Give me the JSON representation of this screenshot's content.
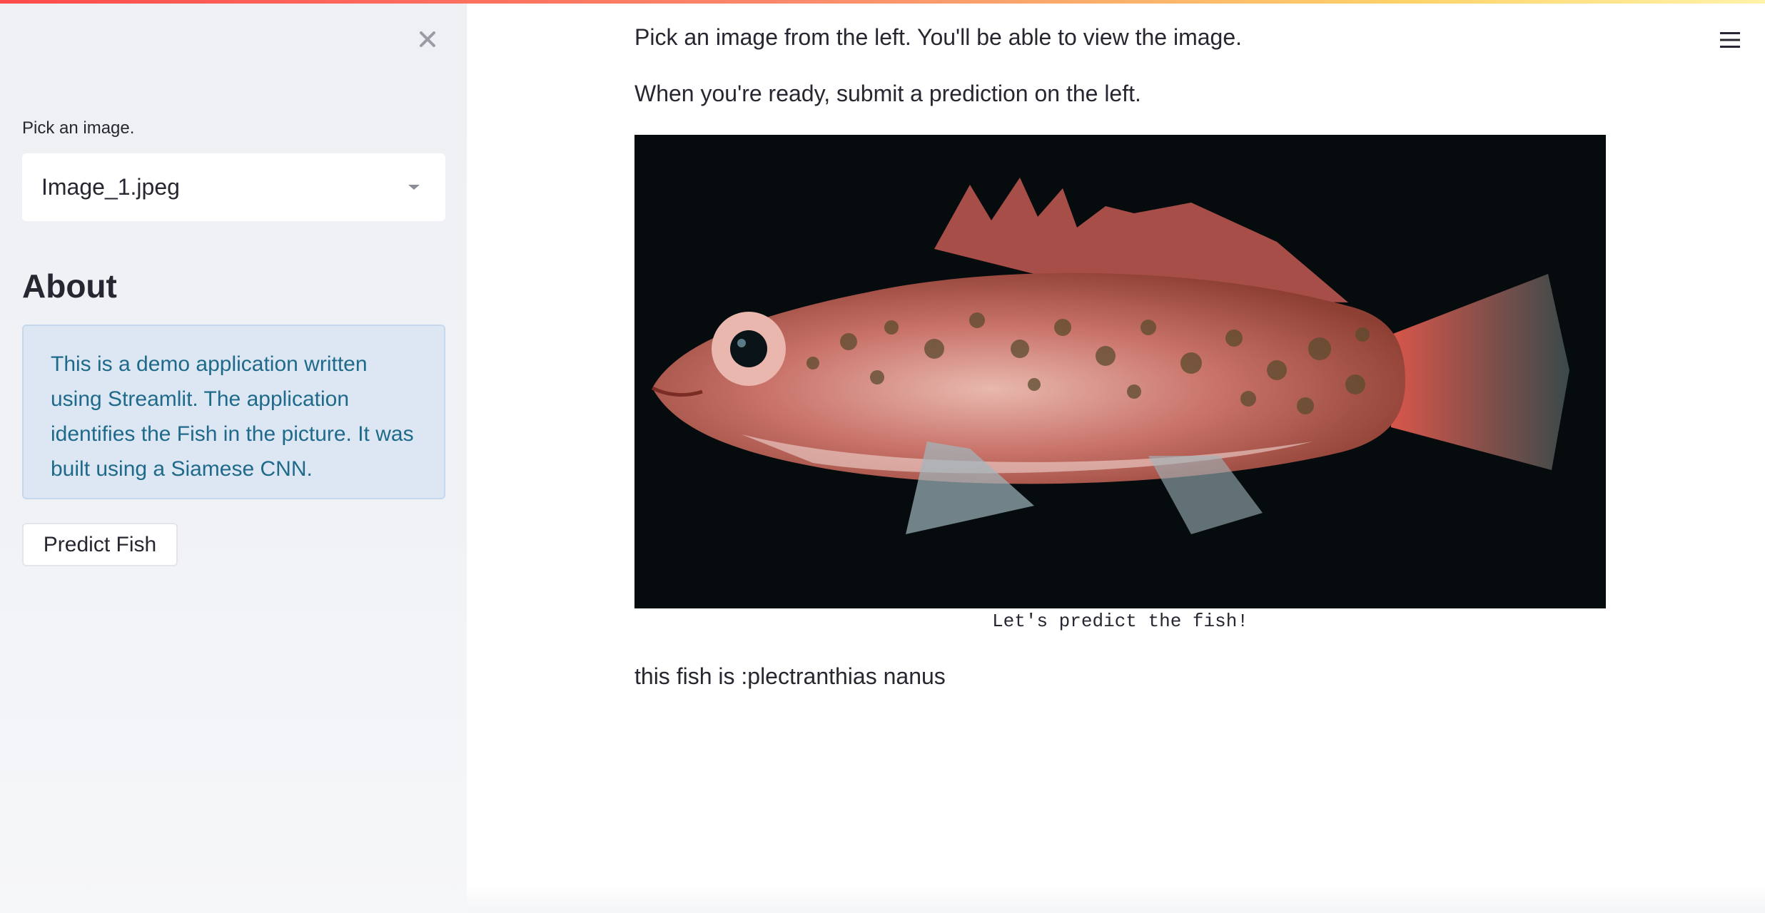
{
  "sidebar": {
    "close_icon": "close-icon",
    "select_label": "Pick an image.",
    "select_value": "Image_1.jpeg",
    "about_heading": "About",
    "about_text": "This is a demo application written using Streamlit. The application identifies the Fish in the picture. It was built using a Siamese CNN.",
    "predict_button": "Predict Fish"
  },
  "header": {
    "menu_icon": "hamburger-menu-icon",
    "accent_gradient": [
      "#ff4b4b",
      "#ffd36a"
    ]
  },
  "main": {
    "instruction_1": "Pick an image from the left. You'll be able to view the image.",
    "instruction_2": "When you're ready, submit a prediction on the left.",
    "image_caption": "Let's predict the fish!",
    "result_text": "this fish is :plectranthias nanus"
  },
  "colors": {
    "sidebar_bg": "#f0f2f6",
    "info_bg": "#dde7f3",
    "info_text": "#1f6a8a",
    "text": "#262730"
  }
}
